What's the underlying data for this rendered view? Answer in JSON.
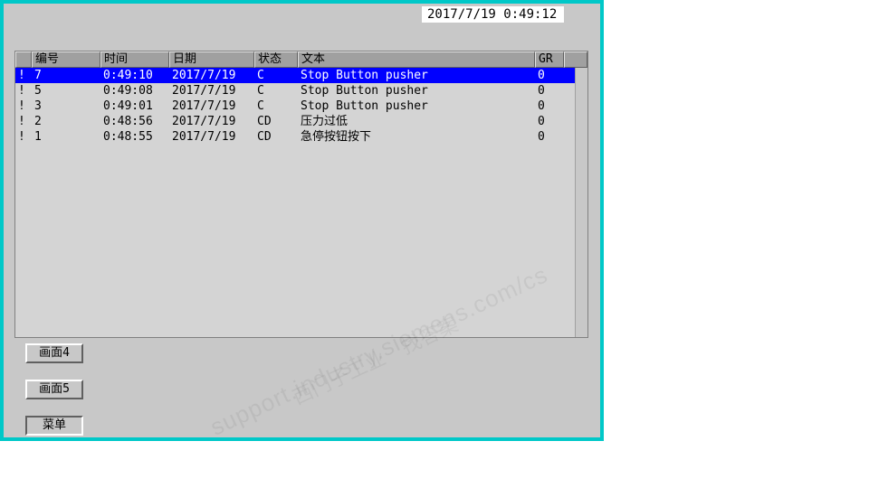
{
  "timestamp": "2017/7/19 0:49:12",
  "columns": {
    "flag": "",
    "no": "编号",
    "time": "时间",
    "date": "日期",
    "state": "状态",
    "text": "文本",
    "gr": "GR",
    "pad": ""
  },
  "rows": [
    {
      "flag": "!",
      "no": "7",
      "time": "0:49:10",
      "date": "2017/7/19",
      "state": "C",
      "text": "Stop  Button pusher",
      "gr": "0",
      "selected": true
    },
    {
      "flag": "!",
      "no": "5",
      "time": "0:49:08",
      "date": "2017/7/19",
      "state": "C",
      "text": "Stop  Button pusher",
      "gr": "0",
      "selected": false
    },
    {
      "flag": "!",
      "no": "3",
      "time": "0:49:01",
      "date": "2017/7/19",
      "state": "C",
      "text": "Stop  Button pusher",
      "gr": "0",
      "selected": false
    },
    {
      "flag": "!",
      "no": "2",
      "time": "0:48:56",
      "date": "2017/7/19",
      "state": "CD",
      "text": "压力过低",
      "gr": "0",
      "selected": false
    },
    {
      "flag": "!",
      "no": "1",
      "time": "0:48:55",
      "date": "2017/7/19",
      "state": "CD",
      "text": "急停按钮按下",
      "gr": "0",
      "selected": false
    }
  ],
  "buttons": {
    "screen4": "画面4",
    "screen5": "画面5",
    "menu": "菜单"
  },
  "watermark_main": "support.industry.siemens.com/cs",
  "watermark_side": "西门子工业　找答案"
}
